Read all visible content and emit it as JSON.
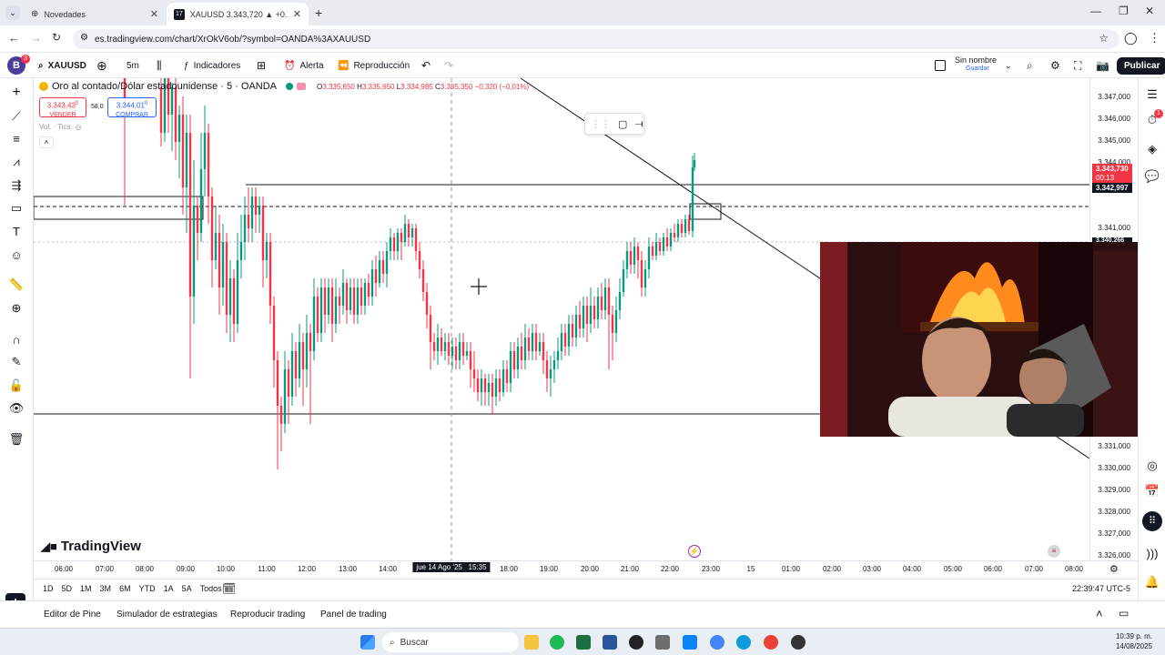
{
  "browser": {
    "tabs": [
      {
        "title": "Novedades",
        "active": false
      },
      {
        "title": "XAUUSD 3.343,720 ▲ +0.24% S",
        "active": true
      }
    ],
    "url": "es.tradingview.com/chart/XrOkV6ob/?symbol=OANDA%3AXAUUSD"
  },
  "toolbar": {
    "avatar_letter": "B",
    "avatar_badge": "3",
    "symbol": "XAUUSD",
    "interval": "5m",
    "indicators_label": "Indicadores",
    "alert_label": "Alerta",
    "replay_label": "Reproducción",
    "layout_name": "Sin nombre",
    "layout_status": "Guardar",
    "publish_label": "Publicar"
  },
  "legend": {
    "title": "Oro al contado/Dólar estadounidense · 5 · OANDA",
    "o_label": "O",
    "o": "3.335,650",
    "h_label": "H",
    "h": "3.335,650",
    "l_label": "L",
    "l": "3.334,985",
    "c_label": "C",
    "c": "3.335,350",
    "change": "−0,320 (−0,01%)",
    "sell_price": "3.343,43",
    "sell_sup": "0",
    "sell_label": "VENDER",
    "spread": "58,0",
    "buy_price": "3.344,01",
    "buy_sup": "0",
    "buy_label": "COMPRAR",
    "volume_label": "Vol. · Tics"
  },
  "price_axis": {
    "labels": [
      "3.347,000",
      "3.346,000",
      "3.345,000",
      "3.344,000",
      "3.341,000",
      "3.331,000",
      "3.330,000",
      "3.329,000",
      "3.328,000",
      "3.327,000",
      "3.326,000"
    ],
    "current_price": "3.343,730",
    "countdown": "00:13",
    "line_price": "3.342,997",
    "partial_label": "3.340,266"
  },
  "time_axis": {
    "labels": [
      "06:00",
      "07:00",
      "08:00",
      "09:00",
      "10:00",
      "11:00",
      "12:00",
      "13:00",
      "14:00",
      "18:00",
      "19:00",
      "20:00",
      "21:00",
      "22:00",
      "23:00",
      "15",
      "01:00",
      "02:00",
      "03:00",
      "04:00",
      "05:00",
      "06:00",
      "07:00",
      "08:00"
    ],
    "crosshair_label": "jue 14 Ago '25   15:35"
  },
  "range_bar": {
    "ranges": [
      "1D",
      "5D",
      "1M",
      "3M",
      "6M",
      "YTD",
      "1A",
      "5A",
      "Todos"
    ],
    "clock": "22:39:47 UTC-5"
  },
  "bottom_tabs": [
    "Editor de Pine",
    "Simulador de estrategias",
    "Reproducir trading",
    "Panel de trading"
  ],
  "brand": "TradingView",
  "taskbar": {
    "search_placeholder": "Buscar",
    "time": "10:39 p. m.",
    "date": "14/08/2025"
  },
  "right_badge": "1",
  "colors": {
    "up": "#089981",
    "down": "#f23645",
    "accent": "#2962ff",
    "dark": "#131722"
  }
}
